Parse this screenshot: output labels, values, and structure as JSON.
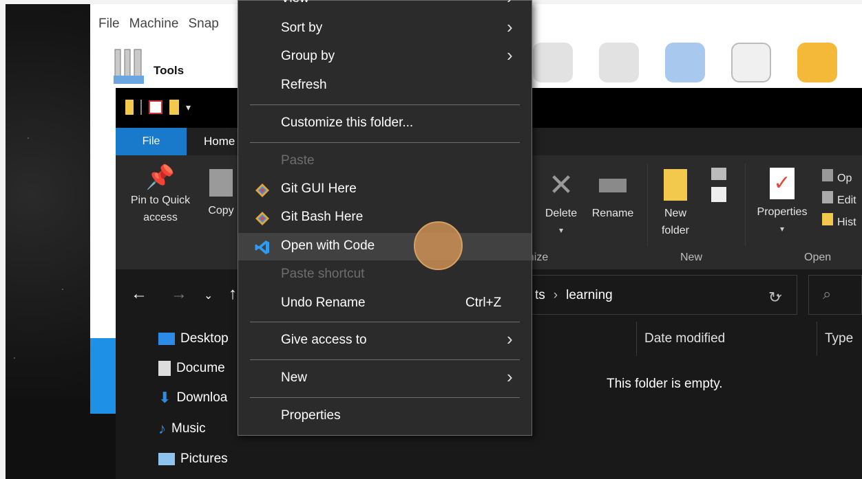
{
  "vbox": {
    "menu": [
      "File",
      "Machine",
      "Snap"
    ],
    "tools_label": "Tools"
  },
  "explorer": {
    "tabs": {
      "file": "File",
      "home": "Home"
    },
    "ribbon": {
      "pin": "Pin to Quick access",
      "copy": "Copy",
      "delete": "Delete",
      "rename": "Rename",
      "new_folder": "New folder",
      "properties": "Properties",
      "open": "Op",
      "edit": "Edit",
      "history": "Hist",
      "group_organize": "anize",
      "group_new": "New",
      "group_open": "Open"
    },
    "address": {
      "prev_segment": "ts",
      "current": "learning"
    },
    "nav_items": [
      "Desktop",
      "Docume",
      "Downloa",
      "Music",
      "Pictures"
    ],
    "columns": {
      "date": "Date modified",
      "type": "Type"
    },
    "empty_message": "This folder is empty."
  },
  "context_menu": {
    "items": [
      {
        "label": "View",
        "arrow": true
      },
      {
        "label": "Sort by",
        "arrow": true
      },
      {
        "label": "Group by",
        "arrow": true
      },
      {
        "label": "Refresh"
      },
      {
        "label": "Customize this folder..."
      },
      {
        "label": "Paste",
        "disabled": true
      },
      {
        "label": "Git GUI Here",
        "icon": "git-icon"
      },
      {
        "label": "Git Bash Here",
        "icon": "git-icon"
      },
      {
        "label": "Open with Code",
        "icon": "vscode-icon",
        "highlighted": true
      },
      {
        "label": "Paste shortcut",
        "disabled": true
      },
      {
        "label": "Undo Rename",
        "shortcut": "Ctrl+Z"
      },
      {
        "label": "Give access to",
        "arrow": true
      },
      {
        "label": "New",
        "arrow": true
      },
      {
        "label": "Properties"
      }
    ]
  },
  "colors": {
    "accent": "#1979ca",
    "menu_bg": "#2b2b2b",
    "cursor": "#d69656"
  }
}
